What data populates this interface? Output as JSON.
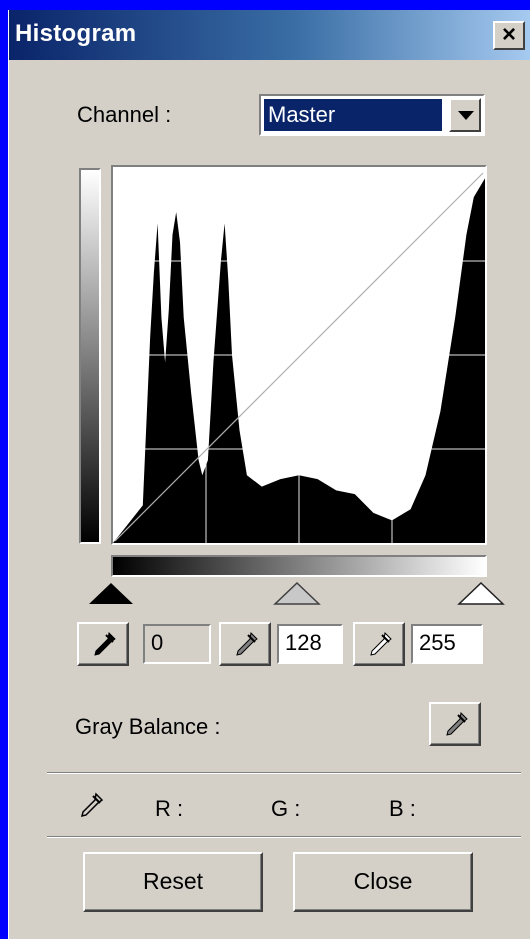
{
  "window": {
    "title": "Histogram",
    "close_glyph": "×"
  },
  "channel": {
    "label": "Channel :",
    "selected": "Master"
  },
  "histogram": {
    "profile": [
      [
        0,
        0
      ],
      [
        0.08,
        0.1
      ],
      [
        0.1,
        0.55
      ],
      [
        0.11,
        0.72
      ],
      [
        0.12,
        0.85
      ],
      [
        0.13,
        0.6
      ],
      [
        0.14,
        0.48
      ],
      [
        0.15,
        0.62
      ],
      [
        0.16,
        0.82
      ],
      [
        0.17,
        0.88
      ],
      [
        0.18,
        0.8
      ],
      [
        0.19,
        0.6
      ],
      [
        0.21,
        0.4
      ],
      [
        0.23,
        0.22
      ],
      [
        0.24,
        0.18
      ],
      [
        0.255,
        0.22
      ],
      [
        0.27,
        0.48
      ],
      [
        0.29,
        0.75
      ],
      [
        0.3,
        0.85
      ],
      [
        0.31,
        0.7
      ],
      [
        0.32,
        0.5
      ],
      [
        0.34,
        0.3
      ],
      [
        0.36,
        0.18
      ],
      [
        0.4,
        0.15
      ],
      [
        0.45,
        0.17
      ],
      [
        0.5,
        0.18
      ],
      [
        0.55,
        0.17
      ],
      [
        0.6,
        0.14
      ],
      [
        0.65,
        0.13
      ],
      [
        0.7,
        0.08
      ],
      [
        0.75,
        0.06
      ],
      [
        0.8,
        0.09
      ],
      [
        0.84,
        0.18
      ],
      [
        0.88,
        0.35
      ],
      [
        0.92,
        0.6
      ],
      [
        0.95,
        0.82
      ],
      [
        0.97,
        0.92
      ],
      [
        1,
        0.97
      ]
    ]
  },
  "levels": {
    "black": "0",
    "gray": "128",
    "white": "255"
  },
  "gray_balance": {
    "label": "Gray Balance :"
  },
  "readout": {
    "r": "R :",
    "g": "G :",
    "b": "B :"
  },
  "buttons": {
    "reset": "Reset",
    "close": "Close"
  },
  "colors": {
    "title_start": "#0a246a",
    "title_end": "#a6caf0",
    "face": "#d4d0c8",
    "selection": "#0a246a"
  },
  "icons": [
    "close-icon",
    "dropdown-arrow-icon",
    "eyedropper-icon"
  ]
}
